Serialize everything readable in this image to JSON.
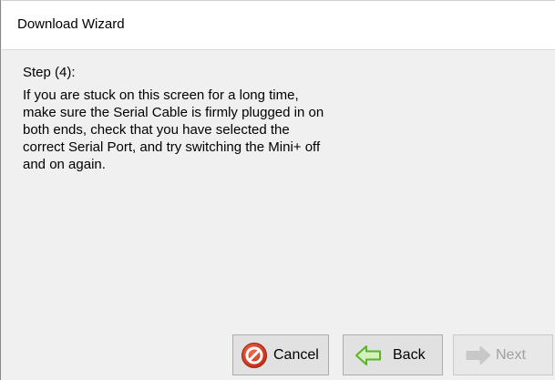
{
  "window": {
    "title": "Download Wizard"
  },
  "content": {
    "step": "Step (4):",
    "lines": [
      "If you are stuck on this screen for a long time,",
      "make sure the Serial Cable is firmly plugged in on",
      "both ends, check that you have selected the",
      "correct Serial Port, and try switching the Mini+ off",
      "and on again."
    ]
  },
  "buttons": {
    "cancel": {
      "label": "Cancel",
      "icon": "cancel-icon",
      "enabled": true
    },
    "back": {
      "label": "Back",
      "icon": "arrow-left-icon",
      "enabled": true
    },
    "next": {
      "label": "Next",
      "icon": "arrow-right-icon",
      "enabled": false
    }
  },
  "colors": {
    "cancel_icon": "#d0331b",
    "back_arrow": "#5cb327",
    "next_arrow_disabled": "#c8c8c8"
  }
}
